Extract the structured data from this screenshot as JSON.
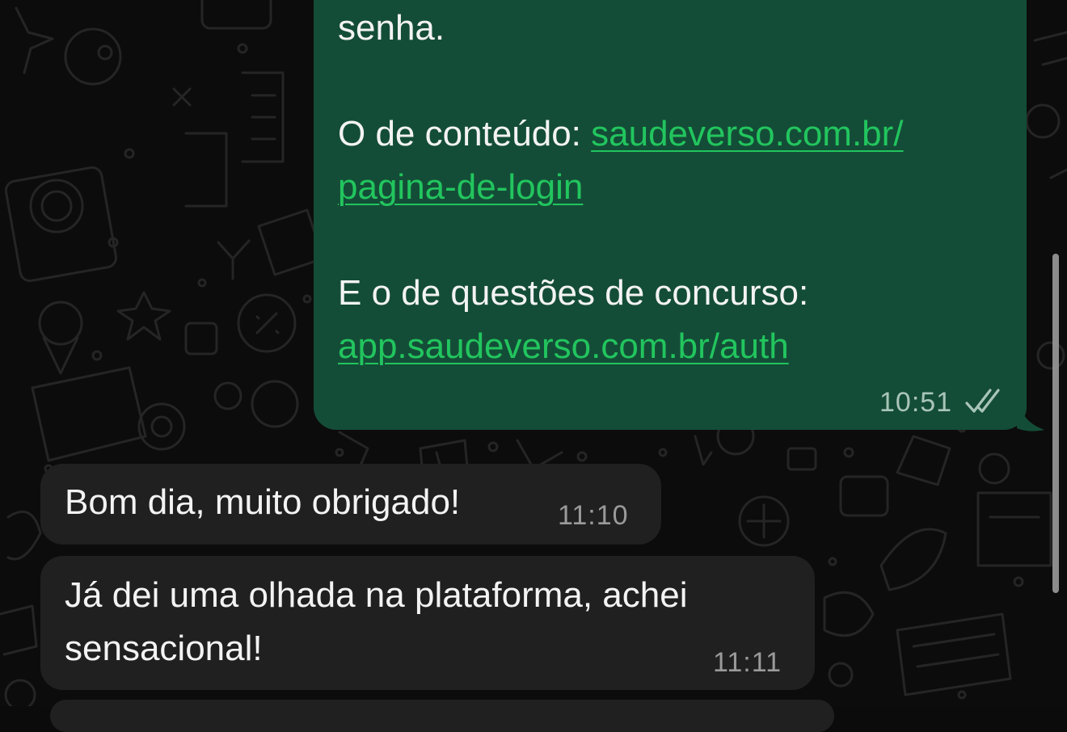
{
  "chat": {
    "outgoing_message": {
      "line1": "senha.",
      "content_prefix": "O de conteúdo: ",
      "content_link_part1": "saudeverso.com.br/",
      "content_link_part2": "pagina-de-login",
      "questions_label": "E o de questões de concurso:",
      "questions_link": "app.saudeverso.com.br/auth",
      "time": "10:51",
      "status_icon": "double-check-icon"
    },
    "incoming_messages": [
      {
        "text": "Bom dia, muito obrigado!",
        "time": "11:10"
      },
      {
        "text_line1": "Já dei uma olhada na plataforma, achei",
        "text_line2": "sensacional!",
        "time": "11:11"
      }
    ]
  },
  "colors": {
    "chat_background": "#0c0c0c",
    "outgoing_bubble": "#144d37",
    "incoming_bubble": "#202020",
    "link": "#22c55e",
    "text": "#f3f3f3"
  }
}
